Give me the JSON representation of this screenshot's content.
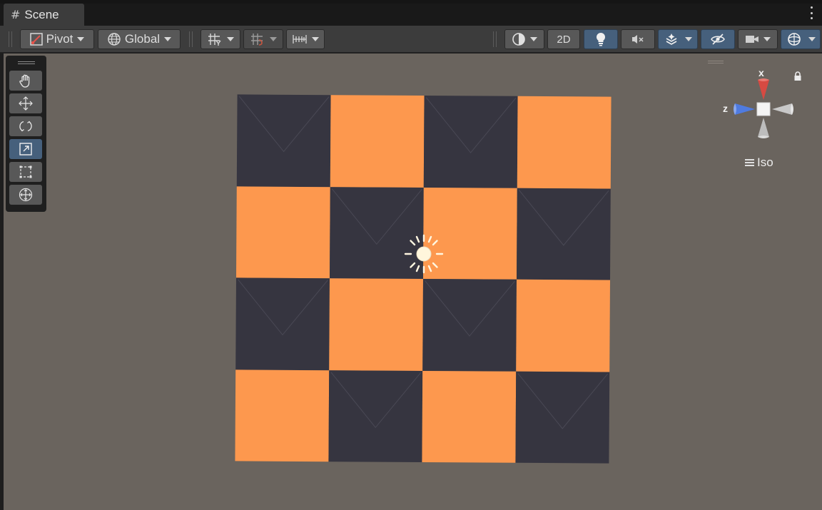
{
  "window": {
    "tab_label": "Scene",
    "tab_icon": "grid-hash-icon"
  },
  "toolbar": {
    "pivot_label": "Pivot",
    "global_label": "Global",
    "mode_2d_label": "2D",
    "icons": {
      "pivot": "pivot-icon",
      "global": "globe-icon",
      "grid_snap": "grid-snap-icon",
      "increment_snap": "increment-snap-icon",
      "ruler": "ruler-icon",
      "shading": "shading-mode-icon",
      "lighting": "lightbulb-icon",
      "audio": "audio-mute-icon",
      "effects": "effects-icon",
      "visibility": "hidden-eye-icon",
      "camera": "camera-icon",
      "gizmos": "gizmos-icon"
    },
    "active_toggles": [
      "lighting",
      "effects",
      "visibility",
      "gizmos"
    ]
  },
  "tools": {
    "items": [
      {
        "name": "hand",
        "icon": "hand-icon",
        "active": false
      },
      {
        "name": "move",
        "icon": "move-icon",
        "active": false
      },
      {
        "name": "rotate",
        "icon": "rotate-icon",
        "active": false
      },
      {
        "name": "scale",
        "icon": "scale-icon",
        "active": true
      },
      {
        "name": "rect",
        "icon": "rect-transform-icon",
        "active": false
      },
      {
        "name": "transform",
        "icon": "transform-icon",
        "active": false
      }
    ]
  },
  "scene": {
    "background_color": "#6a645e",
    "board": {
      "rows": 4,
      "cols": 4,
      "pattern": [
        [
          "dark",
          "orange",
          "dark",
          "orange"
        ],
        [
          "orange",
          "dark",
          "orange",
          "dark"
        ],
        [
          "dark",
          "orange",
          "dark",
          "orange"
        ],
        [
          "orange",
          "dark",
          "orange",
          "dark"
        ]
      ],
      "colors": {
        "dark": "#363540",
        "orange": "#fd984e"
      }
    },
    "light_icon": "sun-icon"
  },
  "gizmo": {
    "x_label": "x",
    "z_label": "z",
    "projection_label": "Iso",
    "colors": {
      "x": "#e0524a",
      "z": "#5a82e6",
      "y": "#cfcfcf"
    }
  }
}
